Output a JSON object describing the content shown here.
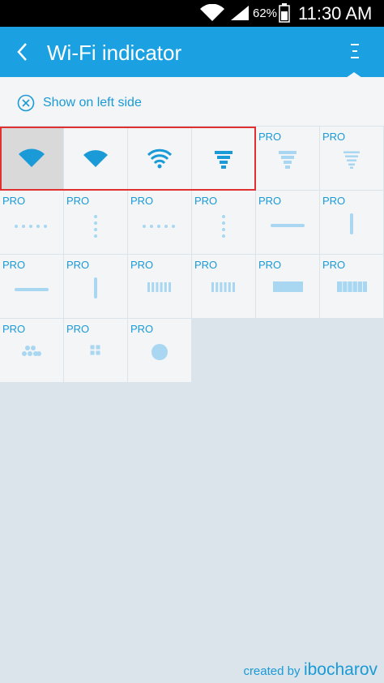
{
  "status_bar": {
    "battery_percent": "62%",
    "time": "11:30 AM"
  },
  "app_bar": {
    "title": "Wi-Fi indicator",
    "back_icon": "chevron-left-icon",
    "menu_icon": "overflow-menu-icon"
  },
  "option": {
    "label": "Show on left side",
    "icon": "circle-x-icon"
  },
  "colors": {
    "accent": "#1ba1e2",
    "icon_active": "#1a9ad6",
    "icon_pro": "#a9d7f2",
    "highlight": "#e03030"
  },
  "grid": {
    "pro_label": "PRO",
    "styles": [
      {
        "name": "wifi-fan-solid",
        "pro": false,
        "selected": true
      },
      {
        "name": "wifi-fan-wide",
        "pro": false,
        "selected": false
      },
      {
        "name": "wifi-arcs",
        "pro": false,
        "selected": false
      },
      {
        "name": "wifi-stacked-bars",
        "pro": false,
        "selected": false
      },
      {
        "name": "stacked-bars-outline",
        "pro": true,
        "selected": false
      },
      {
        "name": "stacked-bars-thin",
        "pro": true,
        "selected": false
      },
      {
        "name": "dots-horizontal",
        "pro": true,
        "selected": false
      },
      {
        "name": "dots-vertical",
        "pro": true,
        "selected": false
      },
      {
        "name": "dots-horizontal-small",
        "pro": true,
        "selected": false
      },
      {
        "name": "dots-vertical-small",
        "pro": true,
        "selected": false
      },
      {
        "name": "line-horizontal",
        "pro": true,
        "selected": false
      },
      {
        "name": "line-vertical",
        "pro": true,
        "selected": false
      },
      {
        "name": "line-horizontal-thick",
        "pro": true,
        "selected": false
      },
      {
        "name": "line-vertical-thick",
        "pro": true,
        "selected": false
      },
      {
        "name": "bars-segmented",
        "pro": true,
        "selected": false
      },
      {
        "name": "bars-segmented-small",
        "pro": true,
        "selected": false
      },
      {
        "name": "block-solid",
        "pro": true,
        "selected": false
      },
      {
        "name": "block-segmented",
        "pro": true,
        "selected": false
      },
      {
        "name": "dots-triangle",
        "pro": true,
        "selected": false
      },
      {
        "name": "dots-square",
        "pro": true,
        "selected": false
      },
      {
        "name": "circle-solid",
        "pro": true,
        "selected": false
      }
    ]
  },
  "footer": {
    "prefix": "created by",
    "author": "ibocharov"
  }
}
